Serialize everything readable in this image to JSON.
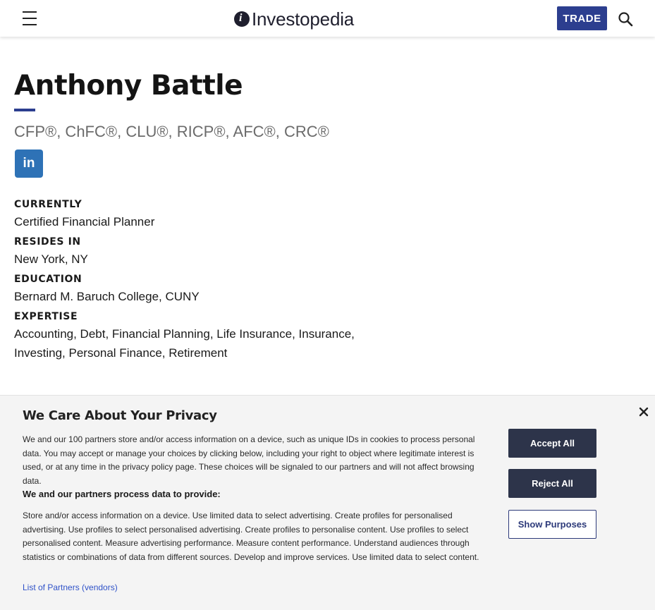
{
  "header": {
    "logo_text": "Investopedia",
    "trade_label": "TRADE"
  },
  "profile": {
    "name": "Anthony Battle",
    "credentials": "CFP®, ChFC®, CLU®, RICP®, AFC®, CRC®",
    "linkedin_label": "in",
    "facts": [
      {
        "label": "CURRENTLY",
        "value": "Certified Financial Planner"
      },
      {
        "label": "RESIDES IN",
        "value": "New York, NY"
      },
      {
        "label": "EDUCATION",
        "value": "Bernard M. Baruch College, CUNY"
      },
      {
        "label": "EXPERTISE",
        "value": "Accounting, Debt, Financial Planning, Life Insurance, Insurance, Investing, Personal Finance, Retirement"
      }
    ]
  },
  "privacy": {
    "title": "We Care About Your Privacy",
    "body": "We and our 100 partners store and/or access information on a device, such as unique IDs in cookies to process personal data. You may accept or manage your choices by clicking below, including your right to object where legitimate interest is used, or at any time in the privacy policy page. These choices will be signaled to our partners and will not affect browsing data.",
    "subheading": "We and our partners process data to provide:",
    "purposes": "Store and/or access information on a device. Use limited data to select advertising. Create profiles for personalised advertising. Use profiles to select personalised advertising. Create profiles to personalise content. Use profiles to select personalised content. Measure advertising performance. Measure content performance. Understand audiences through statistics or combinations of data from different sources. Develop and improve services. Use limited data to select content.",
    "partners_link": "List of Partners (vendors)",
    "accept_label": "Accept All",
    "reject_label": "Reject All",
    "purposes_label": "Show Purposes"
  },
  "colors": {
    "brand_blue": "#2c3e8f",
    "linkedin_blue": "#2e72b6",
    "banner_button": "#2d344a",
    "link_blue": "#2f52c8"
  },
  "icons": [
    "hamburger-menu-icon",
    "search-icon",
    "linkedin-icon",
    "close-icon"
  ]
}
